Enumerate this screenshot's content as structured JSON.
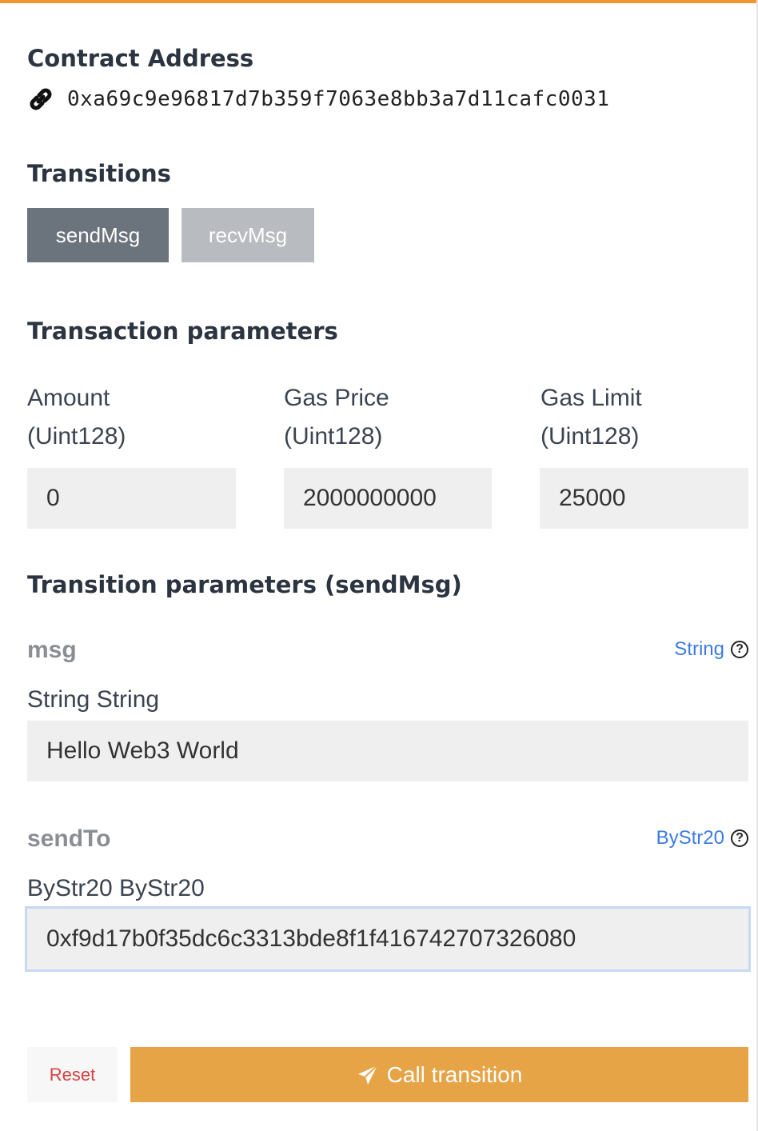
{
  "contract": {
    "heading": "Contract Address",
    "address": "0xa69c9e96817d7b359f7063e8bb3a7d11cafc0031",
    "icon": "link-icon"
  },
  "transitions": {
    "heading": "Transitions",
    "items": [
      {
        "label": "sendMsg",
        "active": true
      },
      {
        "label": "recvMsg",
        "active": false
      }
    ]
  },
  "transaction_params": {
    "heading": "Transaction parameters",
    "amount": {
      "label_line1": "Amount",
      "label_line2": "(Uint128)",
      "value": "0"
    },
    "gas_price": {
      "label_line1": "Gas Price",
      "label_line2": "(Uint128)",
      "value": "2000000000"
    },
    "gas_limit": {
      "label_line1": "Gas Limit",
      "label_line2": "(Uint128)",
      "value": "25000"
    }
  },
  "transition_params": {
    "heading": "Transition parameters (sendMsg)",
    "params": [
      {
        "name": "msg",
        "type": "String",
        "sublabel": "String String",
        "value": "Hello Web3 World"
      },
      {
        "name": "sendTo",
        "type": "ByStr20",
        "sublabel": "ByStr20 ByStr20",
        "value": "0xf9d17b0f35dc6c3313bde8f1f416742707326080"
      }
    ]
  },
  "actions": {
    "reset_label": "Reset",
    "call_label": "Call transition",
    "call_icon": "paper-plane-icon"
  },
  "colors": {
    "accent": "#f0962e",
    "call_button": "#e6a447",
    "reset_text": "#d94040",
    "type_link": "#3d7be0"
  }
}
